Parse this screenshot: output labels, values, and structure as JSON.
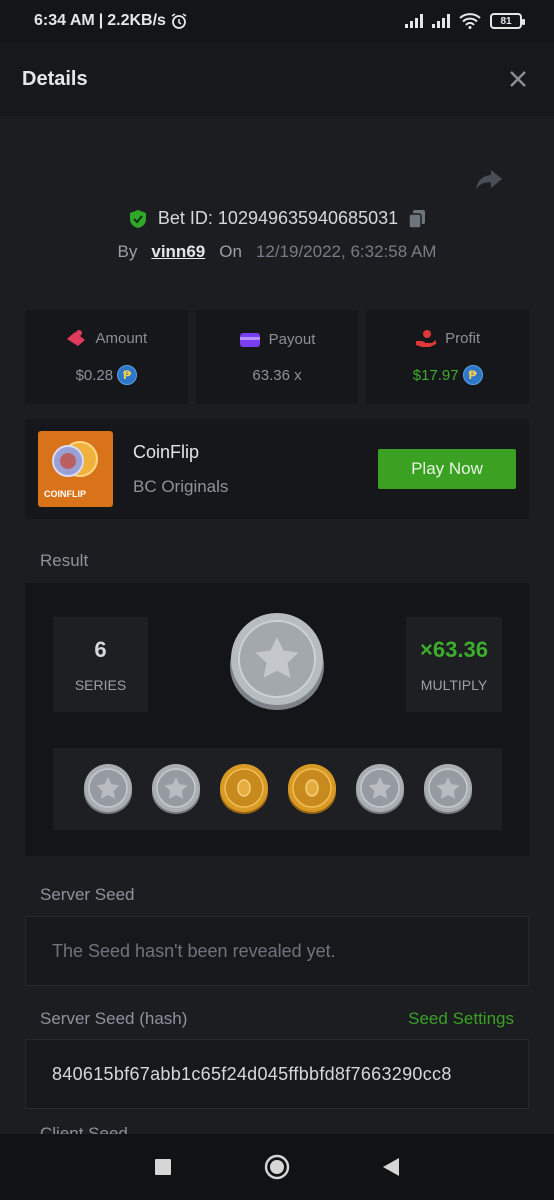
{
  "status": {
    "time": "6:34 AM",
    "speed": "2.2KB/s",
    "battery": "81"
  },
  "header": {
    "title": "Details"
  },
  "bet": {
    "id_label": "Bet ID:",
    "id": "102949635940685031",
    "by_label": "By",
    "user": "vinn69",
    "on_label": "On",
    "date": "12/19/2022, 6:32:58 AM"
  },
  "stats": {
    "amount_label": "Amount",
    "amount": "$0.28",
    "payout_label": "Payout",
    "payout": "63.36 x",
    "profit_label": "Profit",
    "profit": "$17.97",
    "coin_symbol": "₱"
  },
  "game": {
    "thumb_text": "COINFLIP",
    "name": "CoinFlip",
    "provider": "BC Originals",
    "play_label": "Play Now"
  },
  "result": {
    "label": "Result",
    "series_value": "6",
    "series_label": "SERIES",
    "multiply_value": "×63.36",
    "multiply_label": "MULTIPLY",
    "coins": [
      "silver",
      "silver",
      "gold",
      "gold",
      "silver",
      "silver"
    ]
  },
  "server_seed": {
    "label": "Server Seed",
    "value": "The Seed hasn't been revealed yet."
  },
  "server_seed_hash": {
    "label": "Server Seed (hash)",
    "settings_label": "Seed Settings",
    "value": "840615bf67abb1c65f24d045ffbbfd8f7663290cc8"
  },
  "client_seed": {
    "label": "Client Seed"
  },
  "colors": {
    "accent_green": "#3aa123",
    "panel": "#16171a",
    "background": "#1b1d21"
  }
}
